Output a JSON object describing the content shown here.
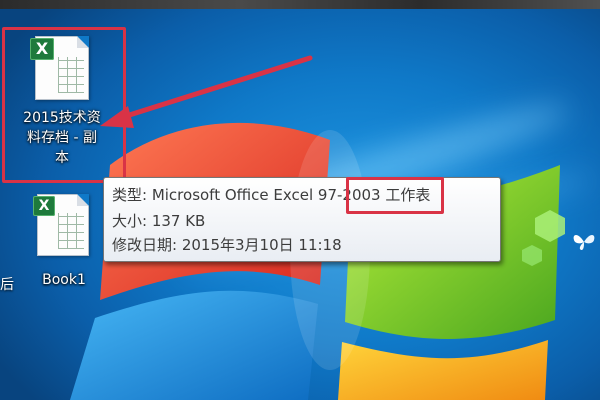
{
  "desktop": {
    "edge_fragment": "后",
    "icons": [
      {
        "label_line1": "2015技术资",
        "label_line2": "料存档 - 副",
        "label_line3": "本",
        "badge": "X"
      },
      {
        "label_line1": "Book1",
        "badge": "X"
      }
    ],
    "tooltip": {
      "type_line": "类型: Microsoft Office Excel 97-2003 工作表",
      "size_line": "大小: 137 KB",
      "modified_line": "修改日期: 2015年3月10日 11:18"
    }
  },
  "colors": {
    "annotation": "#d93346",
    "wallpaper": "#0f79c8",
    "excel_green": "#1e7a3c"
  }
}
